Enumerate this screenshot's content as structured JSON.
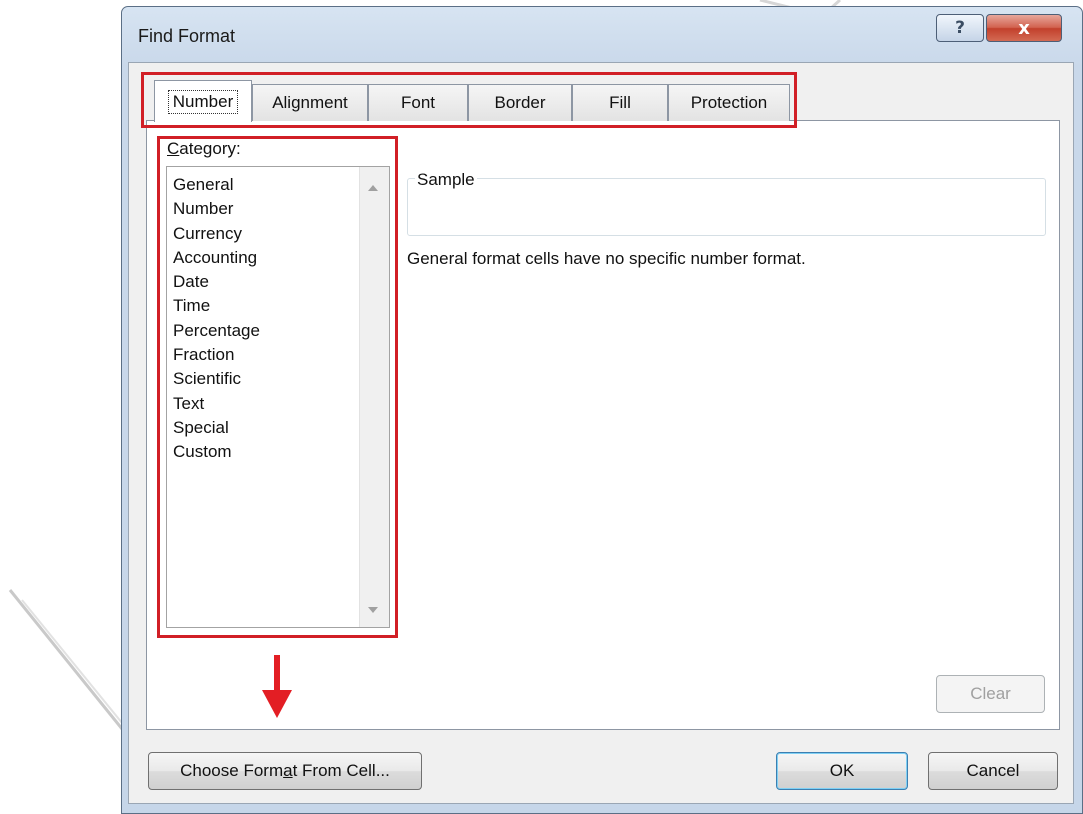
{
  "window": {
    "title": "Find Format",
    "help_icon": "?",
    "close_icon": "x"
  },
  "tabs": [
    {
      "label": "Number",
      "active": true
    },
    {
      "label": "Alignment",
      "active": false
    },
    {
      "label": "Font",
      "active": false
    },
    {
      "label": "Border",
      "active": false
    },
    {
      "label": "Fill",
      "active": false
    },
    {
      "label": "Protection",
      "active": false
    }
  ],
  "number_tab": {
    "category_label_accel": "C",
    "category_label_rest": "ategory:",
    "categories": [
      "General",
      "Number",
      "Currency",
      "Accounting",
      "Date",
      "Time",
      "Percentage",
      "Fraction",
      "Scientific",
      "Text",
      "Special",
      "Custom"
    ],
    "sample_label": "Sample",
    "sample_value": "",
    "description": "General format cells have no specific number format."
  },
  "buttons": {
    "clear": "Clear",
    "choose_pre": "Choose Form",
    "choose_accel": "a",
    "choose_post": "t From Cell...",
    "ok": "OK",
    "cancel": "Cancel"
  },
  "colors": {
    "highlight": "#d11f26",
    "arrow": "#e31e24"
  }
}
